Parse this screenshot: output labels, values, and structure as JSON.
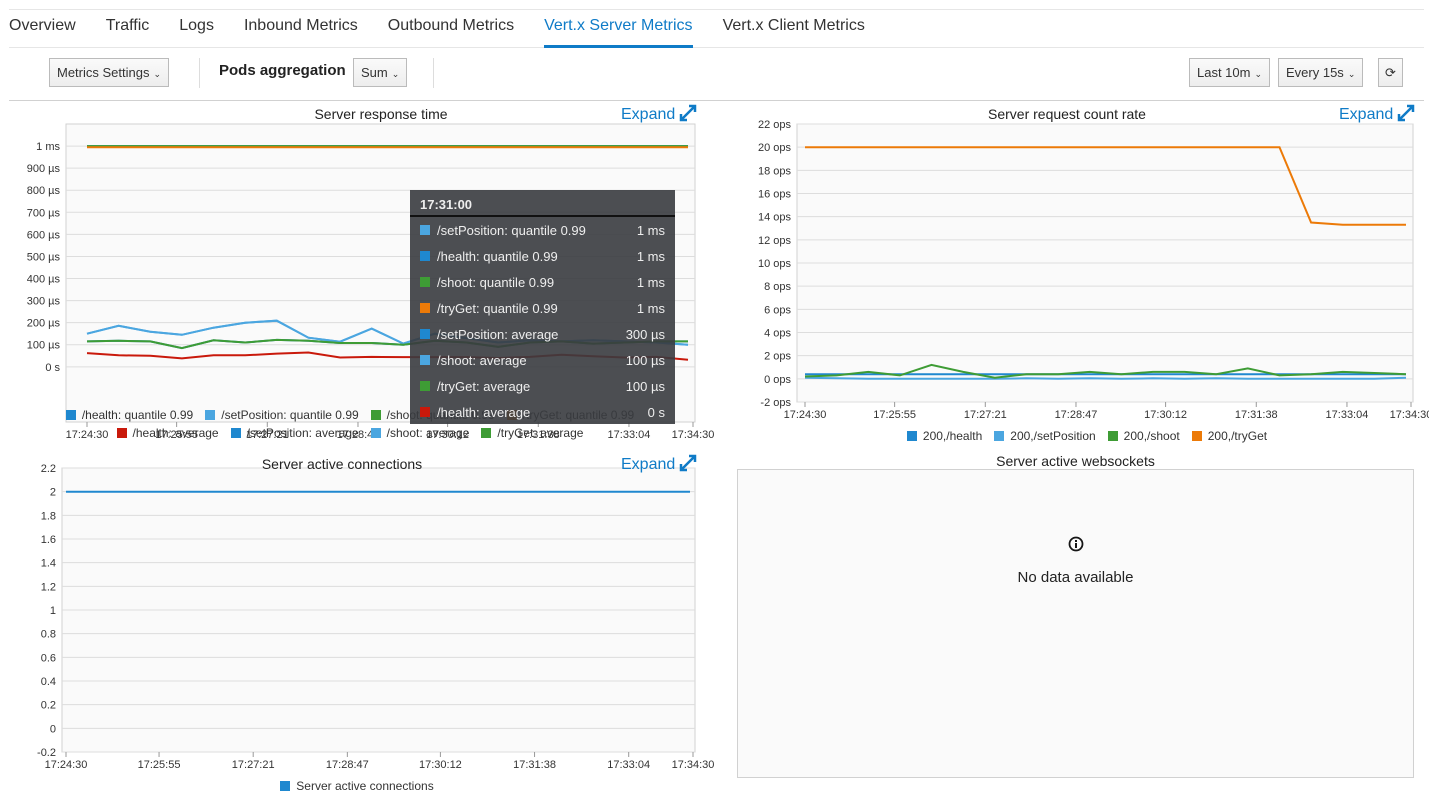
{
  "tabs": [
    {
      "label": "Overview"
    },
    {
      "label": "Traffic"
    },
    {
      "label": "Logs"
    },
    {
      "label": "Inbound Metrics"
    },
    {
      "label": "Outbound Metrics"
    },
    {
      "label": "Vert.x Server Metrics",
      "active": true
    },
    {
      "label": "Vert.x Client Metrics"
    }
  ],
  "toolbar": {
    "metrics_settings": "Metrics Settings",
    "pods_aggregation_label": "Pods aggregation",
    "aggregation_value": "Sum",
    "duration": "Last 10m",
    "refresh_interval": "Every 15s",
    "refresh_icon": "refresh-icon"
  },
  "expand_label": "Expand",
  "colors": {
    "accent": "#0f7bc7",
    "blue": "#1f88cf",
    "lightblue": "#4ba6e0",
    "green": "#3e9c35",
    "orange": "#ec7a08",
    "red": "#c9190b"
  },
  "chart_data": [
    {
      "type": "line",
      "title": "Server response time",
      "unit": "µs",
      "ylim": [
        -250,
        1100
      ],
      "yticks": [
        {
          "v": 0,
          "l": "0 s"
        },
        {
          "v": 100,
          "l": "100 µs"
        },
        {
          "v": 200,
          "l": "200 µs"
        },
        {
          "v": 300,
          "l": "300 µs"
        },
        {
          "v": 400,
          "l": "400 µs"
        },
        {
          "v": 500,
          "l": "500 µs"
        },
        {
          "v": 600,
          "l": "600 µs"
        },
        {
          "v": 700,
          "l": "700 µs"
        },
        {
          "v": 800,
          "l": "800 µs"
        },
        {
          "v": 900,
          "l": "900 µs"
        },
        {
          "v": 1000,
          "l": "1 ms"
        }
      ],
      "xticks": [
        "17:24:30",
        "17:25:55",
        "17:27:21",
        "17:28:47",
        "17:30:12",
        "17:31:38",
        "17:33:04",
        "17:34:30"
      ],
      "x": [
        "17:24:30",
        "17:25:00",
        "17:25:30",
        "17:26:00",
        "17:26:30",
        "17:27:00",
        "17:27:30",
        "17:28:00",
        "17:28:30",
        "17:29:00",
        "17:29:30",
        "17:30:00",
        "17:30:30",
        "17:31:00",
        "17:31:30",
        "17:32:00",
        "17:32:30",
        "17:33:00",
        "17:33:30",
        "17:34:00"
      ],
      "series": [
        {
          "name": "/health: quantile 0.99",
          "color": "#1f88cf",
          "values": [
            1000,
            1000,
            1000,
            1000,
            1000,
            1000,
            1000,
            1000,
            1000,
            1000,
            1000,
            1000,
            1000,
            1000,
            1000,
            1000,
            1000,
            1000,
            1000,
            1000
          ]
        },
        {
          "name": "/setPosition: quantile 0.99",
          "color": "#4ba6e0",
          "values": [
            150,
            186,
            159,
            145,
            177,
            200,
            209,
            132,
            114,
            173,
            105,
            150,
            130,
            110,
            120,
            115,
            120,
            115,
            110,
            100
          ]
        },
        {
          "name": "/shoot: quantile 0.99",
          "color": "#3e9c35",
          "values": [
            1000,
            1000,
            1000,
            1000,
            1000,
            1000,
            1000,
            1000,
            1000,
            1000,
            1000,
            1000,
            1000,
            1000,
            1000,
            1000,
            1000,
            1000,
            1000,
            1000
          ]
        },
        {
          "name": "/tryGet: quantile 0.99",
          "color": "#ec7a08",
          "values": [
            995,
            995,
            995,
            995,
            995,
            995,
            995,
            995,
            995,
            995,
            995,
            995,
            995,
            995,
            995,
            995,
            995,
            995,
            995,
            995
          ]
        },
        {
          "name": "/health: average",
          "color": "#c9190b",
          "values": [
            62,
            52,
            50,
            38,
            52,
            52,
            60,
            65,
            42,
            45,
            44,
            44,
            44,
            40,
            45,
            55,
            48,
            42,
            45,
            32
          ]
        },
        {
          "name": "/setPosition: average",
          "color": "#1f88cf",
          "values": [
            115,
            118,
            115,
            85,
            120,
            110,
            122,
            118,
            108,
            108,
            100,
            118,
            110,
            90,
            110,
            115,
            105,
            110,
            115,
            115
          ]
        },
        {
          "name": "/shoot: average",
          "color": "#4ba6e0",
          "values": [
            150,
            186,
            159,
            145,
            177,
            200,
            209,
            132,
            114,
            173,
            105,
            150,
            130,
            110,
            120,
            115,
            120,
            115,
            110,
            100
          ]
        },
        {
          "name": "/tryGet: average",
          "color": "#3e9c35",
          "values": [
            115,
            118,
            115,
            85,
            120,
            110,
            122,
            118,
            108,
            108,
            100,
            118,
            110,
            90,
            110,
            115,
            105,
            110,
            115,
            115
          ]
        }
      ],
      "tooltip": {
        "time": "17:31:00",
        "rows": [
          {
            "name": "/setPosition: quantile 0.99",
            "value": "1 ms",
            "color": "#4ba6e0"
          },
          {
            "name": "/health: quantile 0.99",
            "value": "1 ms",
            "color": "#1f88cf"
          },
          {
            "name": "/shoot: quantile 0.99",
            "value": "1 ms",
            "color": "#3e9c35"
          },
          {
            "name": "/tryGet: quantile 0.99",
            "value": "1 ms",
            "color": "#ec7a08"
          },
          {
            "name": "/setPosition: average",
            "value": "300 µs",
            "color": "#1f88cf"
          },
          {
            "name": "/shoot: average",
            "value": "100 µs",
            "color": "#4ba6e0"
          },
          {
            "name": "/tryGet: average",
            "value": "100 µs",
            "color": "#3e9c35"
          },
          {
            "name": "/health: average",
            "value": "0 s",
            "color": "#c9190b"
          }
        ]
      }
    },
    {
      "type": "line",
      "title": "Server request count rate",
      "unit": "ops",
      "ylim": [
        -2,
        22
      ],
      "yticks": [
        {
          "v": -2,
          "l": "-2 ops"
        },
        {
          "v": 0,
          "l": "0 ops"
        },
        {
          "v": 2,
          "l": "2 ops"
        },
        {
          "v": 4,
          "l": "4 ops"
        },
        {
          "v": 6,
          "l": "6 ops"
        },
        {
          "v": 8,
          "l": "8 ops"
        },
        {
          "v": 10,
          "l": "10 ops"
        },
        {
          "v": 12,
          "l": "12 ops"
        },
        {
          "v": 14,
          "l": "14 ops"
        },
        {
          "v": 16,
          "l": "16 ops"
        },
        {
          "v": 18,
          "l": "18 ops"
        },
        {
          "v": 20,
          "l": "20 ops"
        },
        {
          "v": 22,
          "l": "22 ops"
        }
      ],
      "xticks": [
        "17:24:30",
        "17:25:55",
        "17:27:21",
        "17:28:47",
        "17:30:12",
        "17:31:38",
        "17:33:04",
        "17:34:30"
      ],
      "x": [
        "17:24:30",
        "17:25:00",
        "17:25:30",
        "17:26:00",
        "17:26:30",
        "17:27:00",
        "17:27:30",
        "17:28:00",
        "17:28:30",
        "17:29:00",
        "17:29:30",
        "17:30:00",
        "17:30:30",
        "17:31:00",
        "17:31:30",
        "17:32:00",
        "17:32:30",
        "17:33:00",
        "17:33:30",
        "17:34:00"
      ],
      "series": [
        {
          "name": "200,/health",
          "color": "#1f88cf",
          "values": [
            0.4,
            0.4,
            0.4,
            0.4,
            0.4,
            0.4,
            0.4,
            0.4,
            0.4,
            0.4,
            0.4,
            0.4,
            0.4,
            0.4,
            0.4,
            0.4,
            0.4,
            0.4,
            0.4,
            0.4
          ]
        },
        {
          "name": "200,/setPosition",
          "color": "#4ba6e0",
          "values": [
            0.1,
            0.05,
            0,
            0,
            0,
            0,
            0,
            0.05,
            0,
            0.05,
            0,
            0.05,
            0,
            0.05,
            0,
            0,
            0,
            0,
            0,
            0.1
          ]
        },
        {
          "name": "200,/shoot",
          "color": "#3e9c35",
          "values": [
            0.2,
            0.3,
            0.6,
            0.3,
            1.2,
            0.6,
            0.1,
            0.4,
            0.4,
            0.6,
            0.4,
            0.6,
            0.6,
            0.4,
            0.9,
            0.3,
            0.4,
            0.6,
            0.5,
            0.4
          ]
        },
        {
          "name": "200,/tryGet",
          "color": "#ec7a08",
          "values": [
            20,
            20,
            20,
            20,
            20,
            20,
            20,
            20,
            20,
            20,
            20,
            20,
            20,
            20,
            20,
            20,
            13.5,
            13.3,
            13.3,
            13.3
          ]
        }
      ]
    },
    {
      "type": "line",
      "title": "Server active connections",
      "ylim": [
        -0.2,
        2.2
      ],
      "yticks": [
        {
          "v": -0.2,
          "l": "-0.2"
        },
        {
          "v": 0,
          "l": "0"
        },
        {
          "v": 0.2,
          "l": "0.2"
        },
        {
          "v": 0.4,
          "l": "0.4"
        },
        {
          "v": 0.6,
          "l": "0.6"
        },
        {
          "v": 0.8,
          "l": "0.8"
        },
        {
          "v": 1,
          "l": "1"
        },
        {
          "v": 1.2,
          "l": "1.2"
        },
        {
          "v": 1.4,
          "l": "1.4"
        },
        {
          "v": 1.6,
          "l": "1.6"
        },
        {
          "v": 1.8,
          "l": "1.8"
        },
        {
          "v": 2,
          "l": "2"
        },
        {
          "v": 2.2,
          "l": "2.2"
        }
      ],
      "xticks": [
        "17:24:30",
        "17:25:55",
        "17:27:21",
        "17:28:47",
        "17:30:12",
        "17:31:38",
        "17:33:04",
        "17:34:30"
      ],
      "x": [
        "17:24:30",
        "17:34:00"
      ],
      "series": [
        {
          "name": "Server active connections",
          "color": "#1f88cf",
          "values": [
            2,
            2
          ]
        }
      ]
    },
    {
      "type": "line",
      "title": "Server active websockets",
      "empty_message": "No data available",
      "icon": "info-icon"
    }
  ]
}
